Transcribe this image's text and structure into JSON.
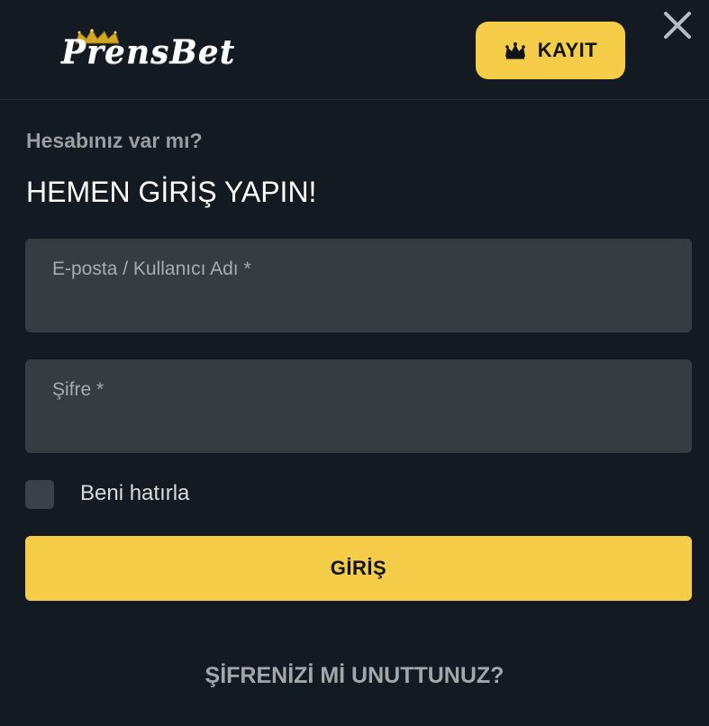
{
  "brand": {
    "logo_text": "PrensBet"
  },
  "header": {
    "register_label": "KAYIT",
    "register_icon": "crown-icon",
    "close_icon": "close-icon"
  },
  "login": {
    "question": "Hesabınız var mı?",
    "headline": "HEMEN GİRİŞ YAPIN!",
    "email_placeholder": "E-posta / Kullanıcı Adı *",
    "email_value": "",
    "password_placeholder": "Şifre *",
    "password_value": "",
    "remember_label": "Beni hatırla",
    "remember_checked": false,
    "submit_label": "GİRİŞ",
    "forgot_label": "ŞİFRENİZİ Mİ UNUTTUNUZ?"
  },
  "colors": {
    "background": "#141a21",
    "accent": "#f5cd48",
    "input_bg": "#363d42"
  }
}
